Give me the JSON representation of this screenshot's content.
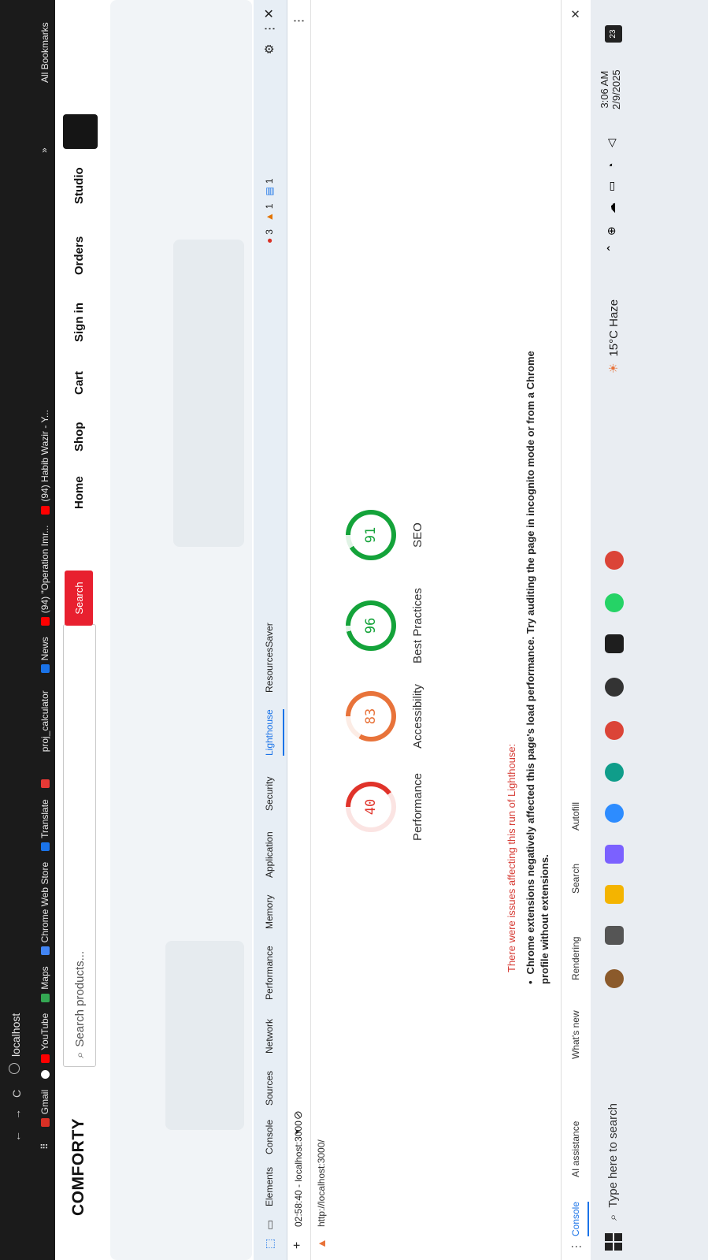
{
  "browser": {
    "back": "←",
    "forward": "→",
    "reload": "C",
    "address": "localhost",
    "bookmarks": [
      "Gmail",
      "YouTube",
      "Maps",
      "Chrome Web Store",
      "Translate",
      "proj_calculator",
      "News",
      "(94) \"Operation Imr...",
      "(94) Habib Wazir - Y..."
    ],
    "more_chevron": "»",
    "all_bookmarks": "All Bookmarks"
  },
  "site": {
    "logo": "COMFORTY",
    "search_placeholder": "Search products...",
    "search_button": "Search",
    "nav": [
      "Home",
      "Shop",
      "Cart",
      "Sign in",
      "Orders",
      "Studio"
    ]
  },
  "devtools": {
    "tabs": [
      "Elements",
      "Console",
      "Sources",
      "Network",
      "Performance",
      "Memory",
      "Application",
      "Security",
      "Lighthouse",
      "ResourcesSaver"
    ],
    "active_tab": "Lighthouse",
    "badges": {
      "errors": "3",
      "warnings": "1",
      "info": "1"
    },
    "report_selector": "02:58:40 - localhost:3000",
    "url": "http://localhost:3000/",
    "scores": [
      {
        "label": "Performance",
        "value": "40",
        "color": "#e0332a",
        "fraction": 0.4
      },
      {
        "label": "Accessibility",
        "value": "83",
        "color": "#e8733a",
        "fraction": 0.83
      },
      {
        "label": "Best Practices",
        "value": "96",
        "color": "#14a33a",
        "fraction": 0.96
      },
      {
        "label": "SEO",
        "value": "91",
        "color": "#14a33a",
        "fraction": 0.91
      }
    ],
    "warning_title": "There were issues affecting this run of Lighthouse:",
    "warning_item": "Chrome extensions negatively affected this page's load performance. Try auditing the page in incognito mode or from a Chrome profile without extensions.",
    "drawer_tabs": [
      "Console",
      "AI assistance",
      "What's new",
      "Rendering",
      "Search",
      "Autofill"
    ]
  },
  "taskbar": {
    "search_placeholder": "Type here to search",
    "weather": "15°C  Haze",
    "time": "3:06 AM",
    "date": "2/9/2025",
    "notifications": "23"
  }
}
